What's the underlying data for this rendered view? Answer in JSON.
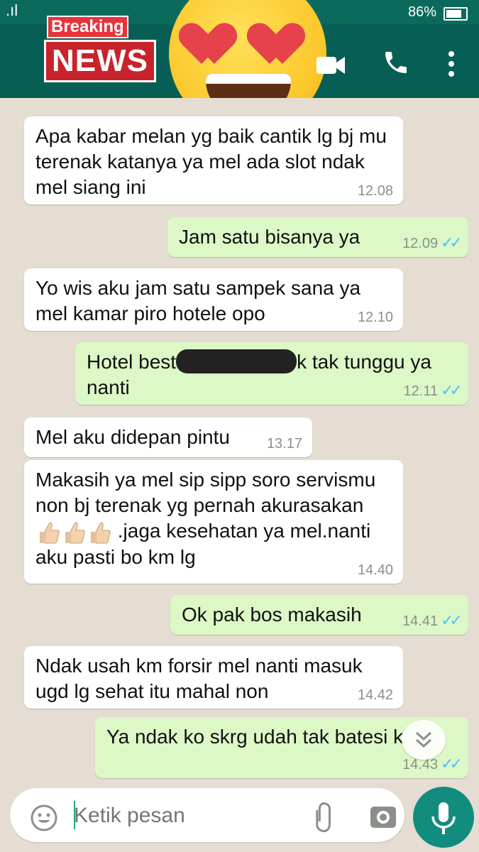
{
  "status_bar": {
    "signal": ".ıl",
    "battery_percent": "86%"
  },
  "header": {
    "overlay_tag": "Breaking",
    "overlay_title": "NEWS",
    "icons": [
      "video-call-icon",
      "voice-call-icon",
      "more-options-icon"
    ]
  },
  "messages": [
    {
      "direction": "in",
      "text": "Apa kabar melan yg baik cantik lg bj mu terenak katanya ya mel ada slot ndak mel siang ini",
      "time": "12.08"
    },
    {
      "direction": "out",
      "text": "Jam satu bisanya ya",
      "time": "12.09",
      "status": "read"
    },
    {
      "direction": "in",
      "text": "Yo wis aku jam satu sampek sana ya mel kamar piro hotele opo",
      "time": "12.10"
    },
    {
      "direction": "out",
      "text_before": "Hotel best",
      "text_after": "k tak tunggu ya nanti",
      "redacted": true,
      "time": "12.11",
      "status": "read"
    },
    {
      "direction": "in",
      "text": "Mel aku didepan pintu",
      "time": "13.17"
    },
    {
      "direction": "in",
      "text_part1": "Makasih ya mel sip sipp soro servismu non bj terenak yg pernah akurasakan",
      "emoji": "thumbs-up x3",
      "text_part2": ".jaga kesehatan ya mel.nanti aku pasti bo km lg",
      "time": "14.40"
    },
    {
      "direction": "out",
      "text": "Ok pak bos makasih",
      "time": "14.41",
      "status": "read"
    },
    {
      "direction": "in",
      "text": "Ndak usah km forsir mel nanti masuk ugd lg sehat itu mahal non",
      "time": "14.42"
    },
    {
      "direction": "out",
      "text": "Ya ndak ko skrg udah tak batesi k",
      "time": "14.43",
      "status": "read"
    }
  ],
  "composer": {
    "placeholder": "Ketik pesan"
  },
  "colors": {
    "header": "#075e54",
    "status_bar": "#0b6a5c",
    "outgoing_bubble": "#dcf8c6",
    "incoming_bubble": "#ffffff",
    "read_ticks": "#4fc3f7",
    "mic_button": "#128c7e"
  }
}
